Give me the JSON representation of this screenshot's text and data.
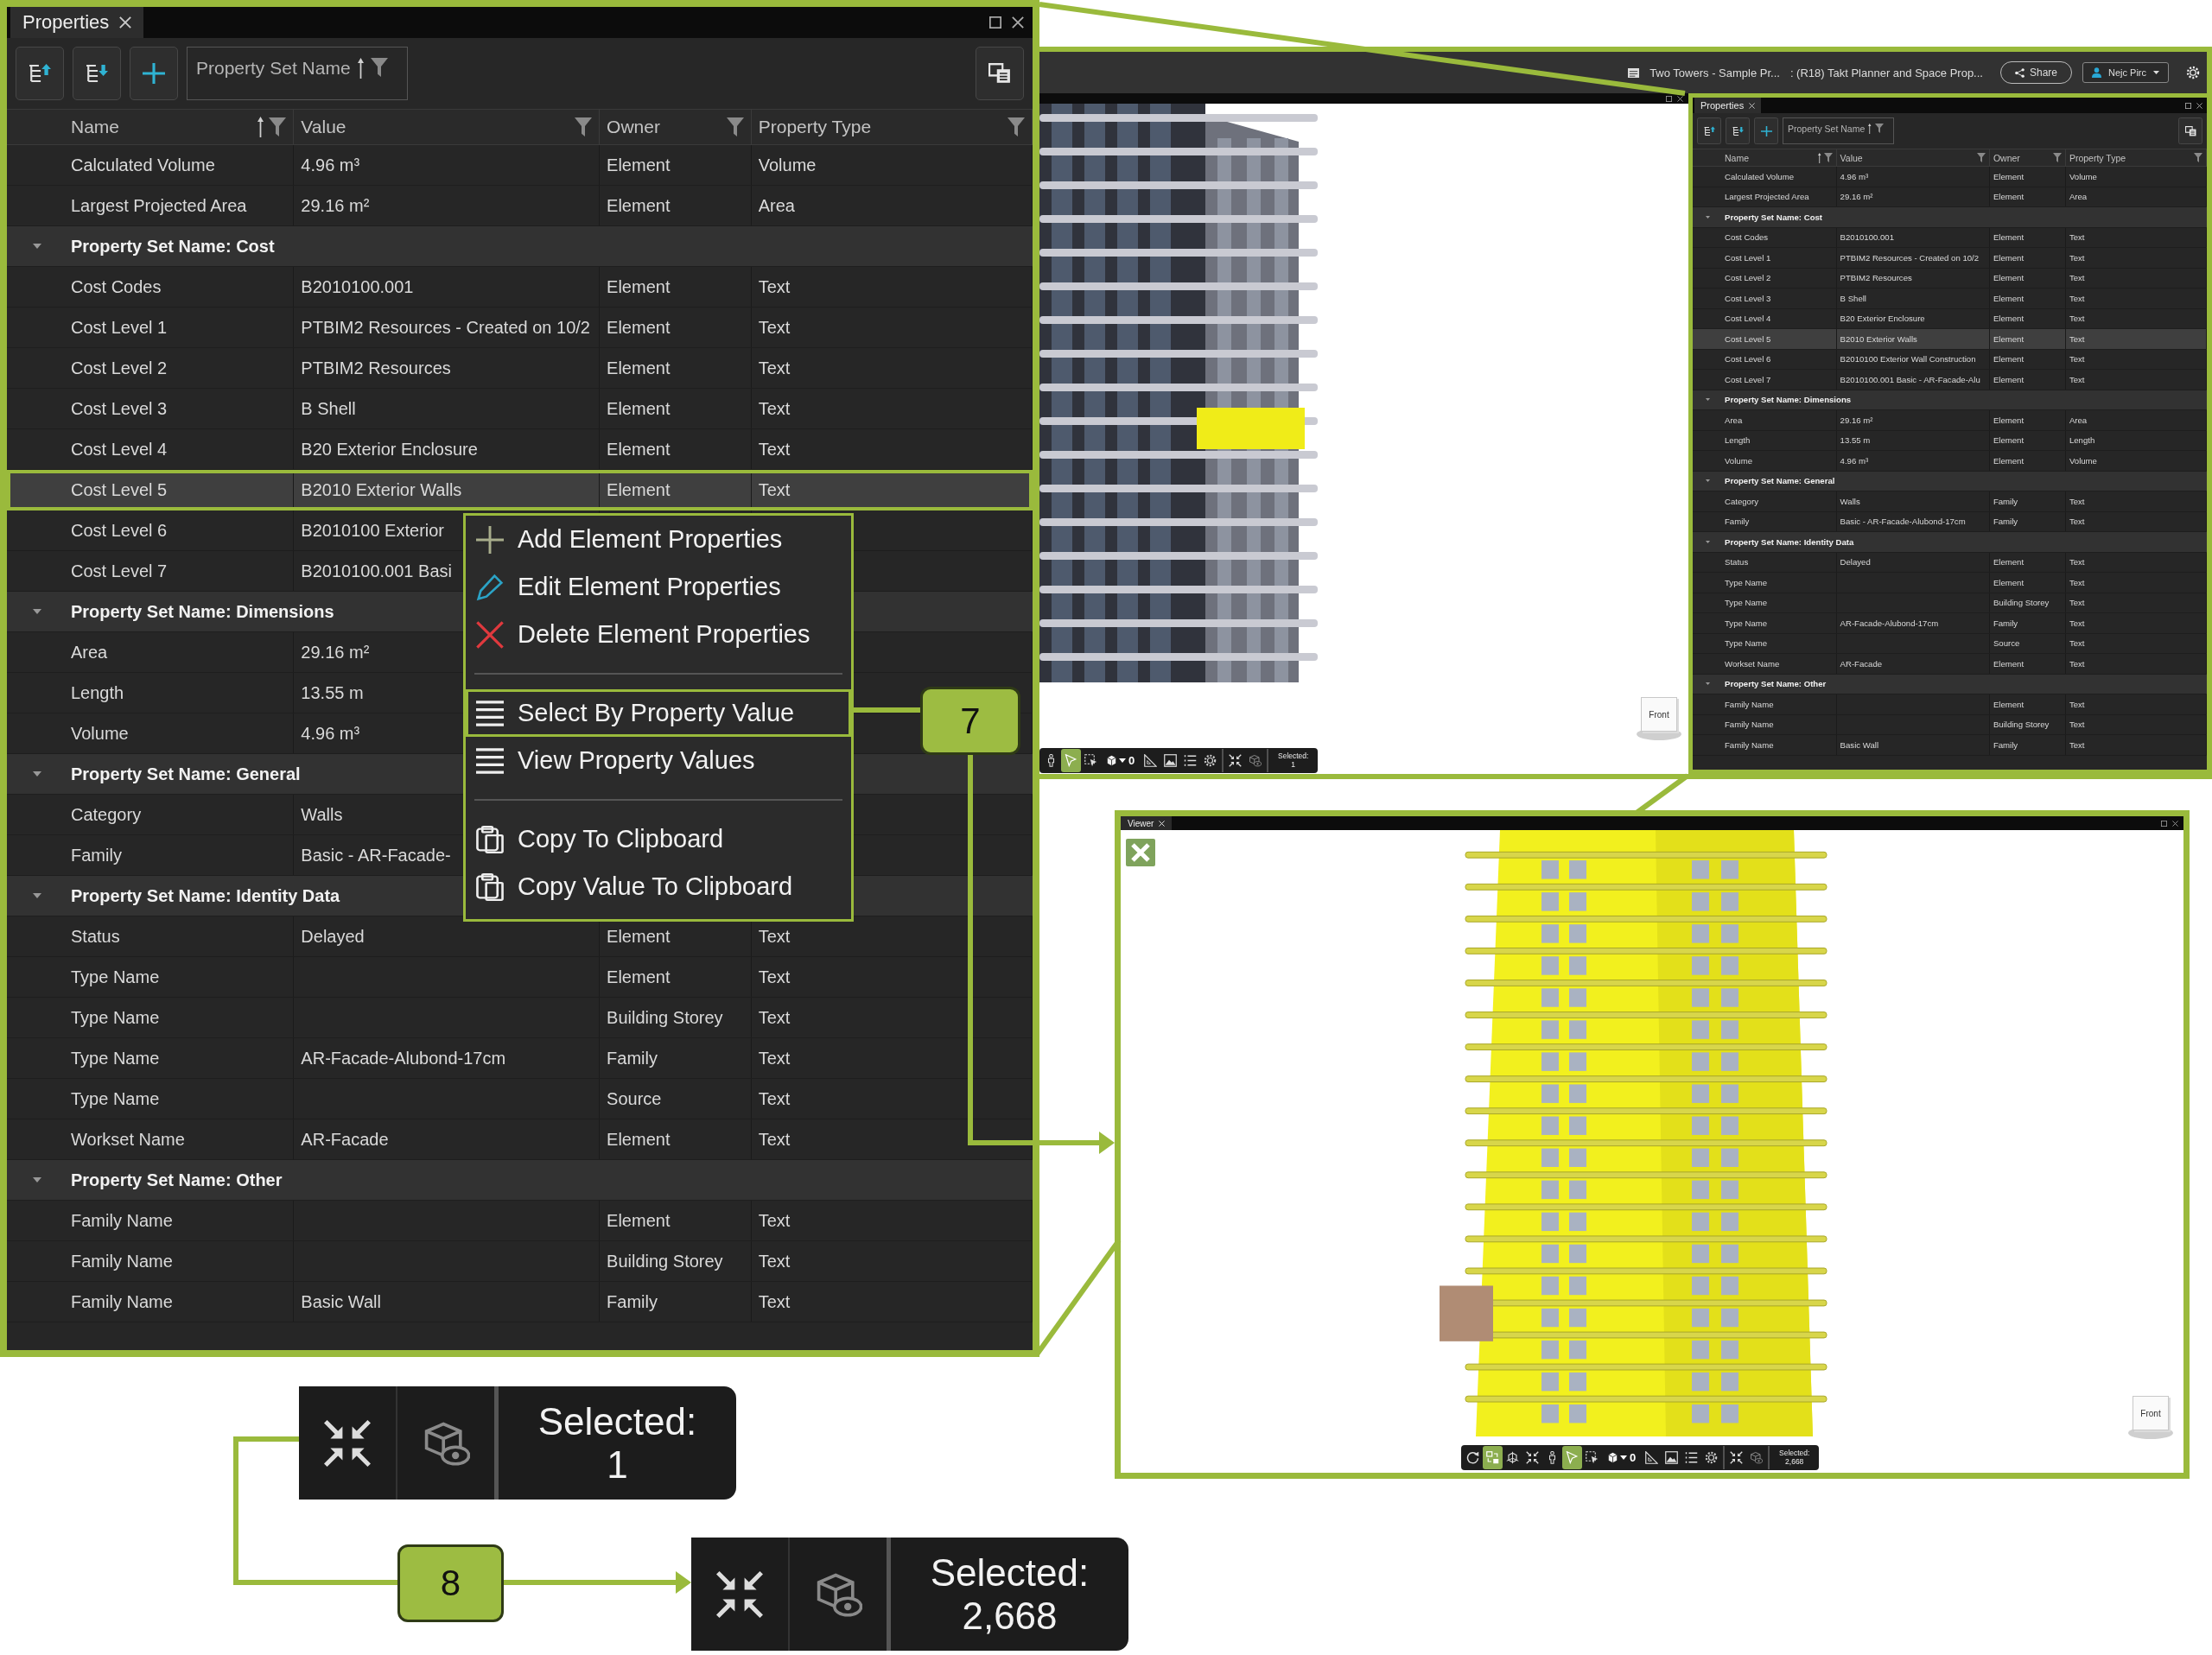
{
  "properties_panel": {
    "tab": "Properties",
    "group_field": "Property Set Name",
    "columns": [
      {
        "label": "Name",
        "sorted": true
      },
      {
        "label": "Value",
        "sorted": false
      },
      {
        "label": "Owner",
        "sorted": false
      },
      {
        "label": "Property Type",
        "sorted": false
      }
    ],
    "rows": [
      {
        "kind": "property",
        "name": "Calculated Volume",
        "value": "4.96 m³",
        "owner": "Element",
        "type": "Volume",
        "selected": false
      },
      {
        "kind": "property",
        "name": "Largest Projected Area",
        "value": "29.16 m²",
        "owner": "Element",
        "type": "Area",
        "selected": false
      },
      {
        "kind": "group",
        "label": "Property Set Name: Cost",
        "expanded": true,
        "selected": false
      },
      {
        "kind": "property",
        "name": "Cost Codes",
        "value": "B2010100.001",
        "owner": "Element",
        "type": "Text",
        "selected": false
      },
      {
        "kind": "property",
        "name": "Cost Level 1",
        "value": "PTBIM2 Resources - Created on 10/2",
        "owner": "Element",
        "type": "Text",
        "selected": false
      },
      {
        "kind": "property",
        "name": "Cost Level 2",
        "value": "PTBIM2 Resources",
        "owner": "Element",
        "type": "Text",
        "selected": false
      },
      {
        "kind": "property",
        "name": "Cost Level 3",
        "value": "B Shell",
        "owner": "Element",
        "type": "Text",
        "selected": false
      },
      {
        "kind": "property",
        "name": "Cost Level 4",
        "value": "B20 Exterior Enclosure",
        "owner": "Element",
        "type": "Text",
        "selected": false
      },
      {
        "kind": "property",
        "name": "Cost Level 5",
        "value": "B2010 Exterior Walls",
        "owner": "Element",
        "type": "Text",
        "selected": true
      },
      {
        "kind": "property",
        "name": "Cost Level 6",
        "value": "B2010100 Exterior",
        "selected": false
      },
      {
        "kind": "property",
        "name": "Cost Level 7",
        "value": "B2010100.001 Basi",
        "selected": false
      },
      {
        "kind": "group",
        "label": "Property Set Name: Dimensions",
        "expanded": true,
        "selected": false
      },
      {
        "kind": "property",
        "name": "Area",
        "value": "29.16 m²",
        "selected": false
      },
      {
        "kind": "property",
        "name": "Length",
        "value": "13.55 m",
        "selected": false
      },
      {
        "kind": "property",
        "name": "Volume",
        "value": "4.96 m³",
        "selected": false
      },
      {
        "kind": "group",
        "label": "Property Set Name: General",
        "expanded": true,
        "selected": false
      },
      {
        "kind": "property",
        "name": "Category",
        "value": "Walls",
        "selected": false
      },
      {
        "kind": "property",
        "name": "Family",
        "value": "Basic - AR-Facade-",
        "selected": false
      },
      {
        "kind": "group",
        "label": "Property Set Name: Identity Data",
        "expanded": true,
        "selected": false
      },
      {
        "kind": "property",
        "name": "Status",
        "value": "Delayed",
        "owner": "Element",
        "type": "Text",
        "selected": false
      },
      {
        "kind": "property",
        "name": "Type Name",
        "owner": "Element",
        "type": "Text",
        "selected": false
      },
      {
        "kind": "property",
        "name": "Type Name",
        "owner": "Building Storey",
        "type": "Text",
        "selected": false
      },
      {
        "kind": "property",
        "name": "Type Name",
        "value": "AR-Facade-Alubond-17cm",
        "owner": "Family",
        "type": "Text",
        "selected": false
      },
      {
        "kind": "property",
        "name": "Type Name",
        "owner": "Source",
        "type": "Text",
        "selected": false
      },
      {
        "kind": "property",
        "name": "Workset Name",
        "value": "AR-Facade",
        "owner": "Element",
        "type": "Text",
        "selected": false
      },
      {
        "kind": "group",
        "label": "Property Set Name: Other",
        "expanded": true,
        "selected": false
      },
      {
        "kind": "property",
        "name": "Family Name",
        "owner": "Element",
        "type": "Text",
        "selected": false
      },
      {
        "kind": "property",
        "name": "Family Name",
        "owner": "Building Storey",
        "type": "Text",
        "selected": false
      },
      {
        "kind": "property",
        "name": "Family Name",
        "value": "Basic Wall",
        "owner": "Family",
        "type": "Text",
        "selected": false
      }
    ]
  },
  "context_menu": {
    "groups": [
      {
        "items": [
          {
            "label": "Add Element Properties",
            "selected": false
          },
          {
            "label": "Edit Element Properties",
            "selected": false
          },
          {
            "label": "Delete Element Properties",
            "selected": false
          }
        ]
      },
      {
        "items": [
          {
            "label": "Select By Property Value",
            "selected": true
          },
          {
            "label": "View Property Values",
            "selected": false
          }
        ]
      },
      {
        "items": [
          {
            "label": "Copy To Clipboard",
            "selected": false
          },
          {
            "label": "Copy Value To Clipboard",
            "selected": false
          }
        ]
      }
    ]
  },
  "callouts": [
    {
      "number": "7"
    },
    {
      "number": "8"
    }
  ],
  "app_window": {
    "document": "Two Towers - Sample Pr...",
    "module": ": (R18) Takt Planner and Space Prop...",
    "share": "Share",
    "user": "Nejc Pirc",
    "viewer": {
      "view_cube": "Front",
      "tools": [
        {
          "kind": "walk",
          "selected": false
        },
        {
          "kind": "select",
          "selected": true
        },
        {
          "kind": "box_select",
          "selected": false
        },
        {
          "kind": "layers",
          "count": "0",
          "selected": false
        },
        {
          "kind": "measure",
          "selected": false
        },
        {
          "kind": "snapshot",
          "selected": false
        },
        {
          "kind": "list",
          "selected": false
        },
        {
          "kind": "settings",
          "selected": false
        }
      ],
      "selection_tools": [
        {
          "kind": "fit"
        },
        {
          "kind": "isolate"
        }
      ],
      "selection": {
        "label": "Selected:",
        "count": "1"
      }
    },
    "properties_panel": {
      "tab": "Properties",
      "group_field": "Property Set Name",
      "columns": [
        {
          "label": "Name",
          "sorted": true
        },
        {
          "label": "Value",
          "sorted": false
        },
        {
          "label": "Owner",
          "sorted": false
        },
        {
          "label": "Property Type",
          "sorted": false
        }
      ],
      "rows": [
        {
          "kind": "property",
          "name": "Calculated Volume",
          "value": "4.96 m³",
          "owner": "Element",
          "type": "Volume",
          "selected": false
        },
        {
          "kind": "property",
          "name": "Largest Projected Area",
          "value": "29.16 m²",
          "owner": "Element",
          "type": "Area",
          "selected": false
        },
        {
          "kind": "group",
          "label": "Property Set Name: Cost",
          "expanded": true,
          "selected": false
        },
        {
          "kind": "property",
          "name": "Cost Codes",
          "value": "B2010100.001",
          "owner": "Element",
          "type": "Text",
          "selected": false
        },
        {
          "kind": "property",
          "name": "Cost Level 1",
          "value": "PTBIM2 Resources - Created on 10/2",
          "owner": "Element",
          "type": "Text",
          "selected": false
        },
        {
          "kind": "property",
          "name": "Cost Level 2",
          "value": "PTBIM2 Resources",
          "owner": "Element",
          "type": "Text",
          "selected": false
        },
        {
          "kind": "property",
          "name": "Cost Level 3",
          "value": "B Shell",
          "owner": "Element",
          "type": "Text",
          "selected": false
        },
        {
          "kind": "property",
          "name": "Cost Level 4",
          "value": "B20 Exterior Enclosure",
          "owner": "Element",
          "type": "Text",
          "selected": false
        },
        {
          "kind": "property",
          "name": "Cost Level 5",
          "value": "B2010 Exterior Walls",
          "owner": "Element",
          "type": "Text",
          "selected": true
        },
        {
          "kind": "property",
          "name": "Cost Level 6",
          "value": "B2010100 Exterior Wall Construction",
          "owner": "Element",
          "type": "Text",
          "selected": false
        },
        {
          "kind": "property",
          "name": "Cost Level 7",
          "value": "B2010100.001 Basic - AR-Facade-Alu",
          "owner": "Element",
          "type": "Text",
          "selected": false
        },
        {
          "kind": "group",
          "label": "Property Set Name: Dimensions",
          "expanded": true,
          "selected": false
        },
        {
          "kind": "property",
          "name": "Area",
          "value": "29.16 m²",
          "owner": "Element",
          "type": "Area",
          "selected": false
        },
        {
          "kind": "property",
          "name": "Length",
          "value": "13.55 m",
          "owner": "Element",
          "type": "Length",
          "selected": false
        },
        {
          "kind": "property",
          "name": "Volume",
          "value": "4.96 m³",
          "owner": "Element",
          "type": "Volume",
          "selected": false
        },
        {
          "kind": "group",
          "label": "Property Set Name: General",
          "expanded": true,
          "selected": false
        },
        {
          "kind": "property",
          "name": "Category",
          "value": "Walls",
          "owner": "Family",
          "type": "Text",
          "selected": false
        },
        {
          "kind": "property",
          "name": "Family",
          "value": "Basic - AR-Facade-Alubond-17cm",
          "owner": "Family",
          "type": "Text",
          "selected": false
        },
        {
          "kind": "group",
          "label": "Property Set Name: Identity Data",
          "expanded": true,
          "selected": false
        },
        {
          "kind": "property",
          "name": "Status",
          "value": "Delayed",
          "owner": "Element",
          "type": "Text",
          "selected": false
        },
        {
          "kind": "property",
          "name": "Type Name",
          "owner": "Element",
          "type": "Text",
          "selected": false
        },
        {
          "kind": "property",
          "name": "Type Name",
          "owner": "Building Storey",
          "type": "Text",
          "selected": false
        },
        {
          "kind": "property",
          "name": "Type Name",
          "value": "AR-Facade-Alubond-17cm",
          "owner": "Family",
          "type": "Text",
          "selected": false
        },
        {
          "kind": "property",
          "name": "Type Name",
          "owner": "Source",
          "type": "Text",
          "selected": false
        },
        {
          "kind": "property",
          "name": "Workset Name",
          "value": "AR-Facade",
          "owner": "Element",
          "type": "Text",
          "selected": false
        },
        {
          "kind": "group",
          "label": "Property Set Name: Other",
          "expanded": true,
          "selected": false
        },
        {
          "kind": "property",
          "name": "Family Name",
          "owner": "Element",
          "type": "Text",
          "selected": false
        },
        {
          "kind": "property",
          "name": "Family Name",
          "owner": "Building Storey",
          "type": "Text",
          "selected": false
        },
        {
          "kind": "property",
          "name": "Family Name",
          "value": "Basic Wall",
          "owner": "Family",
          "type": "Text",
          "selected": false
        }
      ]
    }
  },
  "viewer": {
    "tab": "Viewer",
    "view_cube": "Front",
    "tools": [
      {
        "kind": "orbit",
        "selected": false
      },
      {
        "kind": "transform",
        "selected": true
      },
      {
        "kind": "view",
        "selected": false
      },
      {
        "kind": "fit",
        "selected": false
      },
      {
        "kind": "walk",
        "selected": false
      },
      {
        "kind": "select",
        "selected": true
      },
      {
        "kind": "box_select",
        "selected": false
      },
      {
        "kind": "layers",
        "count": "0",
        "selected": false
      },
      {
        "kind": "measure",
        "selected": false
      },
      {
        "kind": "snapshot",
        "selected": false
      },
      {
        "kind": "list",
        "selected": false
      },
      {
        "kind": "settings",
        "selected": false
      }
    ],
    "selection_tools": [
      {
        "kind": "fit"
      },
      {
        "kind": "isolate"
      }
    ],
    "selection": {
      "label": "Selected:",
      "count": "2,668"
    }
  },
  "insets": [
    {
      "selection_tools": [
        {
          "kind": "fit"
        },
        {
          "kind": "isolate"
        }
      ],
      "selection": {
        "label": "Selected:",
        "count": "1"
      }
    },
    {
      "selection_tools": [
        {
          "kind": "fit"
        },
        {
          "kind": "isolate"
        }
      ],
      "selection": {
        "label": "Selected:",
        "count": "2,668"
      }
    }
  ]
}
